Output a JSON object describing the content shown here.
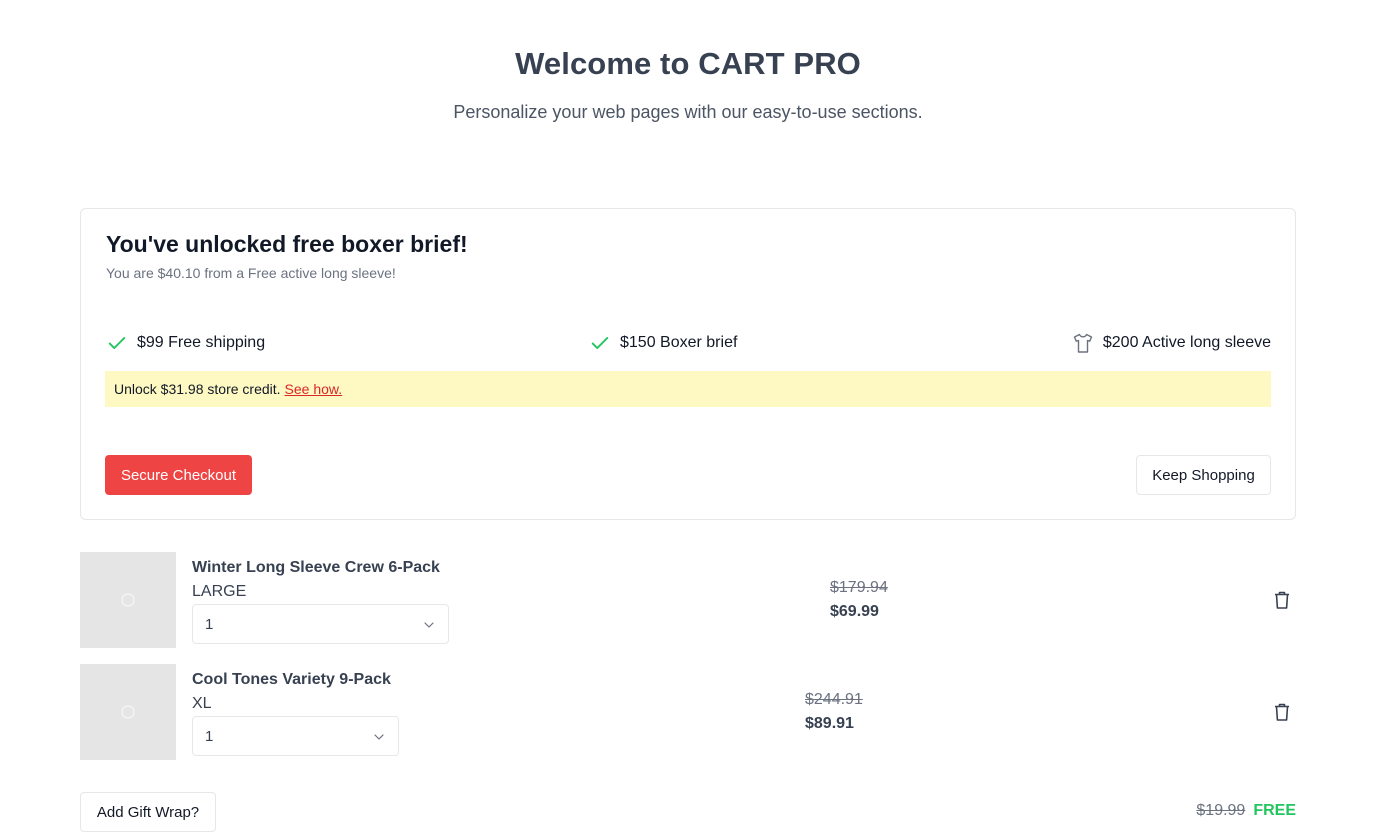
{
  "hero": {
    "title": "Welcome to CART PRO",
    "subtitle": "Personalize your web pages with our easy-to-use sections."
  },
  "rewards": {
    "heading": "You've unlocked free boxer brief!",
    "progress_text": "You are $40.10 from a Free active long sleeve!",
    "tiers": [
      {
        "label": "$99 Free shipping",
        "icon": "check-icon",
        "unlocked": true
      },
      {
        "label": "$150 Boxer brief",
        "icon": "check-icon",
        "unlocked": true
      },
      {
        "label": "$200 Active long sleeve",
        "icon": "shirt-icon",
        "unlocked": false
      }
    ],
    "notice": {
      "text": "Unlock $31.98 store credit.",
      "link": "See how."
    },
    "checkout_label": "Secure Checkout",
    "keep_shopping_label": "Keep Shopping"
  },
  "cart": {
    "items": [
      {
        "name": "Winter Long Sleeve Crew 6-Pack",
        "variant": "LARGE",
        "quantity": "1",
        "price_original": "$179.94",
        "price": "$69.99"
      },
      {
        "name": "Cool Tones Variety 9-Pack",
        "variant": "XL",
        "quantity": "1",
        "price_original": "$244.91",
        "price": "$89.91"
      }
    ],
    "gift_wrap": {
      "label": "Add Gift Wrap?",
      "price_original": "$19.99",
      "price": "FREE"
    }
  },
  "colors": {
    "accent": "#ef4444",
    "success": "#22c55e",
    "notice_bg": "#fef9c3"
  }
}
